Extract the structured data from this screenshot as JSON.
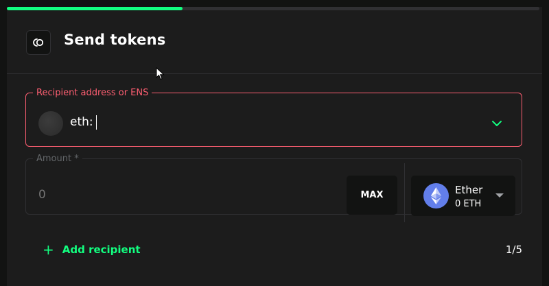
{
  "progress": {
    "fraction": 0.33
  },
  "header": {
    "title": "Send tokens",
    "back_icon": "back-arrow-icon"
  },
  "recipient": {
    "label": "Recipient address or ENS",
    "prefix": "eth:",
    "value": "",
    "border_color": "#ff5f72"
  },
  "amount": {
    "label": "Amount *",
    "placeholder": "0",
    "max_label": "MAX"
  },
  "token": {
    "name": "Ether",
    "balance": "0 ETH",
    "icon": "ethereum-icon"
  },
  "footer": {
    "add_recipient_plus": "+",
    "add_recipient_label": "Add recipient",
    "counter": "1/5"
  },
  "colors": {
    "accent": "#12ff80",
    "error": "#ff5f72",
    "background": "#1c1c1c"
  }
}
